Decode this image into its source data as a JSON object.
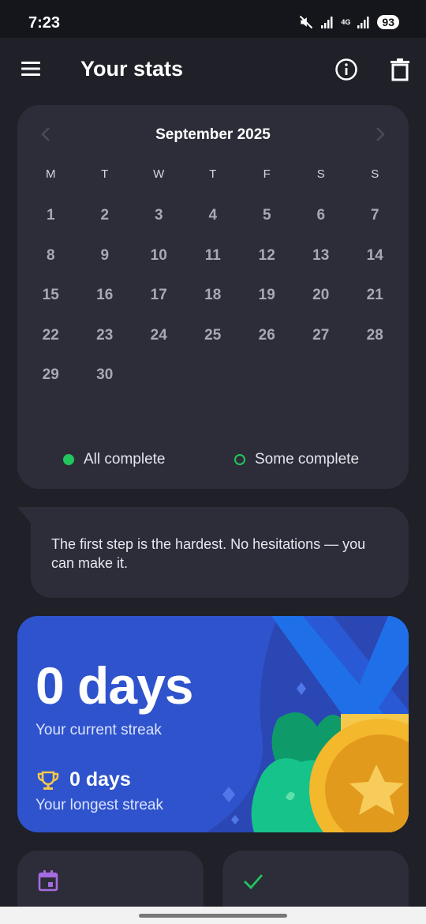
{
  "status": {
    "time": "7:23",
    "net": "4G",
    "battery": "93"
  },
  "appbar": {
    "title": "Your stats",
    "icons": [
      "menu-icon",
      "info-icon",
      "trash-icon"
    ]
  },
  "calendar": {
    "month": "September 2025",
    "weekdays": [
      "M",
      "T",
      "W",
      "T",
      "F",
      "S",
      "S"
    ],
    "weeks": [
      [
        "1",
        "2",
        "3",
        "4",
        "5",
        "6",
        "7"
      ],
      [
        "8",
        "9",
        "10",
        "11",
        "12",
        "13",
        "14"
      ],
      [
        "15",
        "16",
        "17",
        "18",
        "19",
        "20",
        "21"
      ],
      [
        "22",
        "23",
        "24",
        "25",
        "26",
        "27",
        "28"
      ],
      [
        "29",
        "30",
        "",
        "",
        "",
        "",
        ""
      ]
    ],
    "legend_all": "All complete",
    "legend_some": "Some complete",
    "accent": "#22c55e"
  },
  "quote": {
    "text": "The first step is the hardest. No hesitations — you can make it."
  },
  "streak": {
    "current": "0 days",
    "current_label": "Your current streak",
    "longest": "0 days",
    "longest_label": "Your longest streak",
    "card_color": "#2f53cc"
  },
  "bottom_cards": {
    "left_icon": "calendar-icon",
    "right_icon": "check-icon"
  }
}
